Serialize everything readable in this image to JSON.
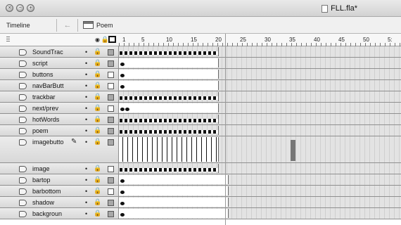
{
  "window": {
    "title": "FLL.fla*"
  },
  "toolbar": {
    "timeline_label": "Timeline",
    "back_icon": "back-arrow-icon",
    "scene_label": "Poem",
    "scene_icon": "clapper-icon"
  },
  "header": {
    "eye_icon": "eye-icon",
    "lock_icon": "lock-icon",
    "outline_icon": "outline-box-icon"
  },
  "ruler": {
    "labels": [
      "1",
      "5",
      "10",
      "15",
      "20",
      "25",
      "30",
      "35",
      "40",
      "45",
      "50",
      "5:"
    ],
    "positions": [
      174,
      201,
      236,
      271,
      306,
      341,
      376,
      411,
      446,
      481,
      516,
      551
    ],
    "current_frame": "20"
  },
  "layers": [
    {
      "name": "SoundTrac",
      "color": "#a8a8a8",
      "frames": 20,
      "keyframes": "continuous"
    },
    {
      "name": "script",
      "color": "#a8a8a8",
      "frames": 20,
      "keyframes": "start-end-hollow"
    },
    {
      "name": "buttons",
      "color": "#ffffff",
      "frames": 20,
      "keyframes": "start-end"
    },
    {
      "name": "navBarButt",
      "color": "#ffffff",
      "frames": 20,
      "keyframes": "start-end"
    },
    {
      "name": "trackbar",
      "color": "#a8a8a8",
      "frames": 20,
      "keyframes": "continuous"
    },
    {
      "name": "next/prev",
      "color": "#ffffff",
      "frames": 20,
      "keyframes": "double-start"
    },
    {
      "name": "hotWords",
      "color": "#a8a8a8",
      "frames": 20,
      "keyframes": "continuous"
    },
    {
      "name": "poem",
      "color": "#a8a8a8",
      "frames": 20,
      "keyframes": "continuous"
    },
    {
      "name": "imagebutto",
      "color": "#a8a8a8",
      "frames": 20,
      "keyframes": "motion"
    },
    {
      "name": "image",
      "color": "#ffffff",
      "frames": 20,
      "keyframes": "continuous"
    },
    {
      "name": "bartop",
      "color": "#a8a8a8",
      "frames": 22,
      "keyframes": "start-end"
    },
    {
      "name": "barbottom",
      "color": "#ffffff",
      "frames": 22,
      "keyframes": "start-end"
    },
    {
      "name": "shadow",
      "color": "#a8a8a8",
      "frames": 22,
      "keyframes": "start-end"
    },
    {
      "name": "backgroun",
      "color": "#a8a8a8",
      "frames": 22,
      "keyframes": "start-end"
    }
  ]
}
